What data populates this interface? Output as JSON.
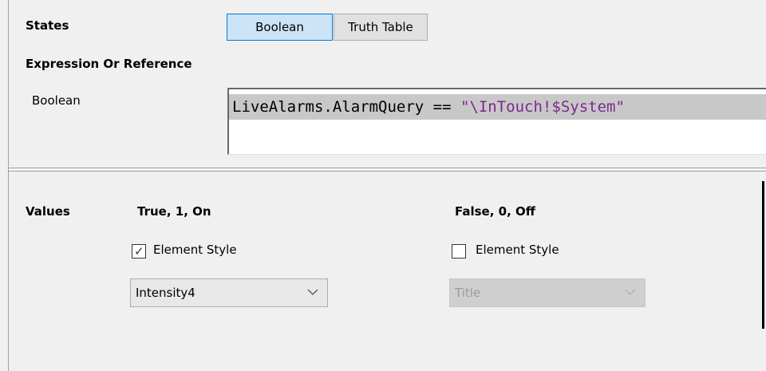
{
  "states": {
    "label": "States",
    "tabs": [
      {
        "label": "Boolean",
        "active": true
      },
      {
        "label": "Truth Table",
        "active": false
      }
    ]
  },
  "expression": {
    "heading": "Expression Or Reference",
    "type_label": "Boolean",
    "code_ref": "LiveAlarms.AlarmQuery == ",
    "code_string": "\"\\InTouch!$System\""
  },
  "values": {
    "label": "Values",
    "true_column": {
      "header": "True, 1, On",
      "checkbox_label": "Element Style",
      "checked": true,
      "combo_value": "Intensity4",
      "enabled": true
    },
    "false_column": {
      "header": "False, 0, Off",
      "checkbox_label": "Element Style",
      "checked": false,
      "combo_value": "Title",
      "enabled": false
    }
  },
  "colors": {
    "active_tab": "#cce4f7",
    "active_tab_border": "#0078d7",
    "string_literal": "#7b2a8c"
  }
}
